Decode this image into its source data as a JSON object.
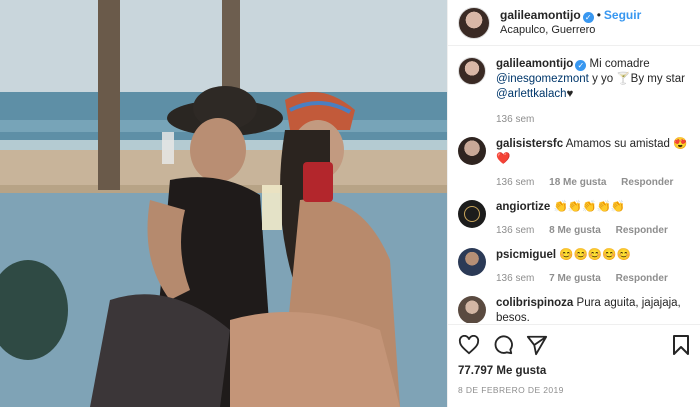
{
  "post_author": {
    "username": "galileamontijo",
    "follow_label": "Seguir",
    "location": "Acapulco, Guerrero"
  },
  "caption": {
    "username": "galileamontijo",
    "text_start": "Mi comadre",
    "mention1": "@inesgomezmont",
    "text_mid": "y yo 🍸By my star",
    "mention2": "@arlettkalach",
    "text_end": "♥",
    "time": "136 sem"
  },
  "comments": [
    {
      "username": "galisistersfc",
      "text": "Amamos su amistad 😍❤️",
      "time": "136 sem",
      "likes": "18 Me gusta",
      "reply": "Responder"
    },
    {
      "username": "angiortize",
      "text": "👏👏👏👏👏",
      "time": "136 sem",
      "likes": "8 Me gusta",
      "reply": "Responder"
    },
    {
      "username": "psicmiguel",
      "text": "😊😊😊😊😊",
      "time": "136 sem",
      "likes": "7 Me gusta",
      "reply": "Responder"
    },
    {
      "username": "colibrispinoza",
      "text": "Pura aguita, jajajaja, besos.",
      "time": "",
      "likes": "",
      "reply": ""
    }
  ],
  "stats": {
    "likes": "77.797",
    "likes_label": "Me gusta",
    "date": "8 DE FEBRERO DE 2019"
  },
  "icons": [
    "heart-icon",
    "comment-icon",
    "share-icon",
    "bookmark-icon"
  ],
  "colors": {
    "accent": "#3897f0",
    "text": "#262626",
    "muted": "#8e8e8e"
  }
}
